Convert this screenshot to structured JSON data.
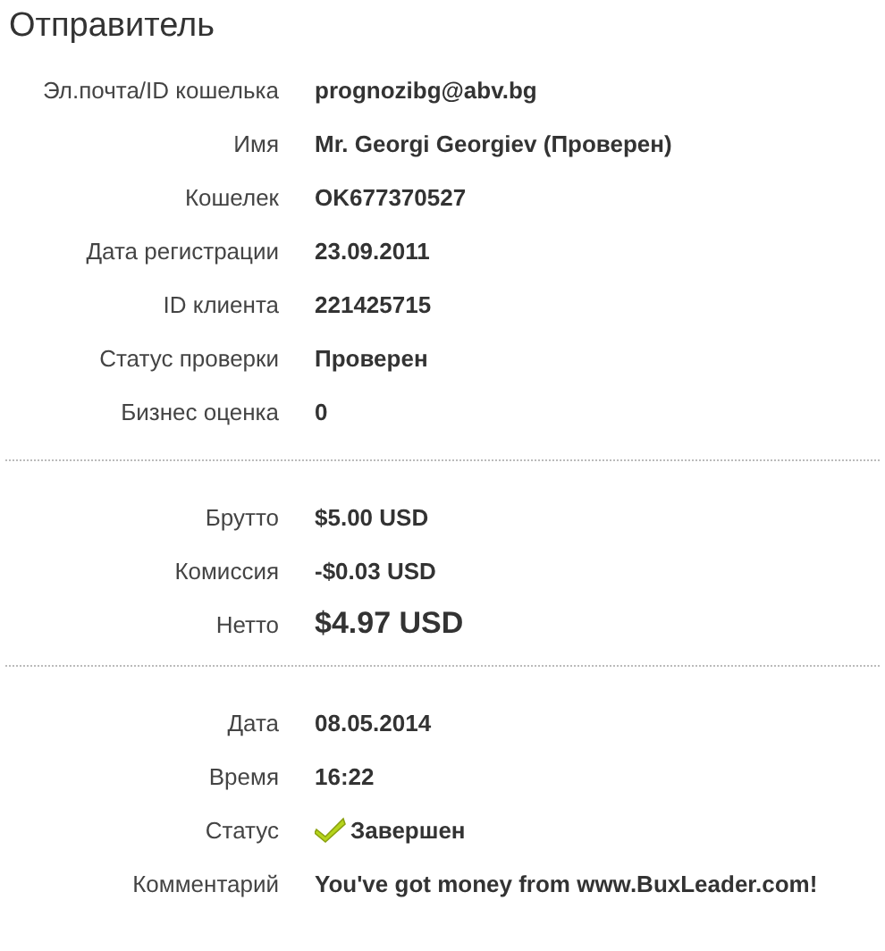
{
  "title": "Отправитель",
  "sections": [
    {
      "rows": [
        {
          "kind": "text",
          "label": "Эл.почта/ID кошелька",
          "value": "prognozibg@abv.bg"
        },
        {
          "kind": "text",
          "label": "Имя",
          "value": "Mr. Georgi Georgiev (Проверен)"
        },
        {
          "kind": "text",
          "label": "Кошелек",
          "value": "OK677370527"
        },
        {
          "kind": "text",
          "label": "Дата регистрации",
          "value": "23.09.2011"
        },
        {
          "kind": "text",
          "label": "ID клиента",
          "value": "221425715"
        },
        {
          "kind": "text",
          "label": "Статус проверки",
          "value": "Проверен"
        },
        {
          "kind": "text",
          "label": "Бизнес оценка",
          "value": "0"
        }
      ]
    },
    {
      "rows": [
        {
          "kind": "text",
          "label": "Брутто",
          "value": "$5.00 USD"
        },
        {
          "kind": "text",
          "label": "Комиссия",
          "value": "-$0.03 USD"
        },
        {
          "kind": "large",
          "label": "Нетто",
          "value": "$4.97 USD"
        }
      ]
    },
    {
      "rows": [
        {
          "kind": "text",
          "label": "Дата",
          "value": "08.05.2014"
        },
        {
          "kind": "text",
          "label": "Время",
          "value": "16:22"
        },
        {
          "kind": "status",
          "label": "Статус",
          "value": "Завершен"
        },
        {
          "kind": "text",
          "label": "Комментарий",
          "value": "You've got money from www.BuxLeader.com!"
        }
      ]
    }
  ]
}
